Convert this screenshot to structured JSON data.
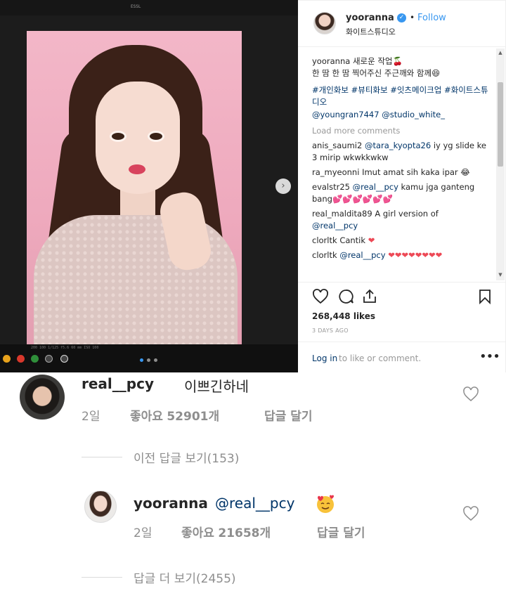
{
  "post": {
    "screen_caption": "200  100  1/125  f5.6  60 mm                   ISO 100",
    "carousel_dots": 3,
    "header": {
      "username": "yooranna",
      "verified_mark": "✓",
      "bullet": "•",
      "follow": "Follow",
      "location": "화이트스튜디오"
    },
    "caption": {
      "user": "yooranna",
      "line1": "새로운 작업",
      "line2": "한 땀 한 땀 찍어주신 주근깨와 함께",
      "hashtags": "#개인화보 #뷰티화보 #잇츠메이크업 #화이트스튜디오",
      "mentions": "@youngran7447 @studio_white_"
    },
    "load_more": "Load more comments",
    "comments": [
      {
        "user": "anis_saumi2",
        "mention": "@tara_kyopta26",
        "text": "iy yg slide ke 3 mirip wkwkkwkw"
      },
      {
        "user": "ra_myeonni",
        "mention": "",
        "text": "Imut amat sih kaka ipar 😂"
      },
      {
        "user": "evalstr25",
        "mention": "@real__pcy",
        "text": "kamu jga ganteng bang",
        "hearts": "💕💕💕💕💕💕"
      },
      {
        "user": "real_maldita89",
        "mention": "",
        "text": "A girl version of",
        "mention_after": "@real__pcy"
      },
      {
        "user": "clorltk",
        "mention": "",
        "text": "Cantik",
        "hearts": "❤"
      },
      {
        "user": "clorltk",
        "mention": "@real__pcy",
        "text": "",
        "hearts": "❤❤❤❤❤❤❤❤"
      }
    ],
    "likes": "268,448 likes",
    "time_ago": "3 DAYS AGO",
    "login_link": "Log in",
    "login_rest": "to like or comment.",
    "more": "•••"
  },
  "thread": {
    "comment": {
      "user": "real__pcy",
      "text": "이쁘긴하네",
      "time": "2일",
      "likes_label": "좋아요",
      "likes_count": "52901",
      "likes_unit": "개",
      "reply": "답글 달기"
    },
    "view_previous": "이전 답글 보기(153)",
    "reply": {
      "user": "yooranna",
      "mention": "@real__pcy",
      "time": "2일",
      "likes_label": "좋아요",
      "likes_count": "21658",
      "likes_unit": "개",
      "reply": "답글 달기"
    },
    "view_more": "답글 더 보기(2455)"
  },
  "colors": {
    "link_blue": "#003569",
    "follow_blue": "#3897f0",
    "muted": "#8e8e8e",
    "heart_red": "#ed4956"
  }
}
